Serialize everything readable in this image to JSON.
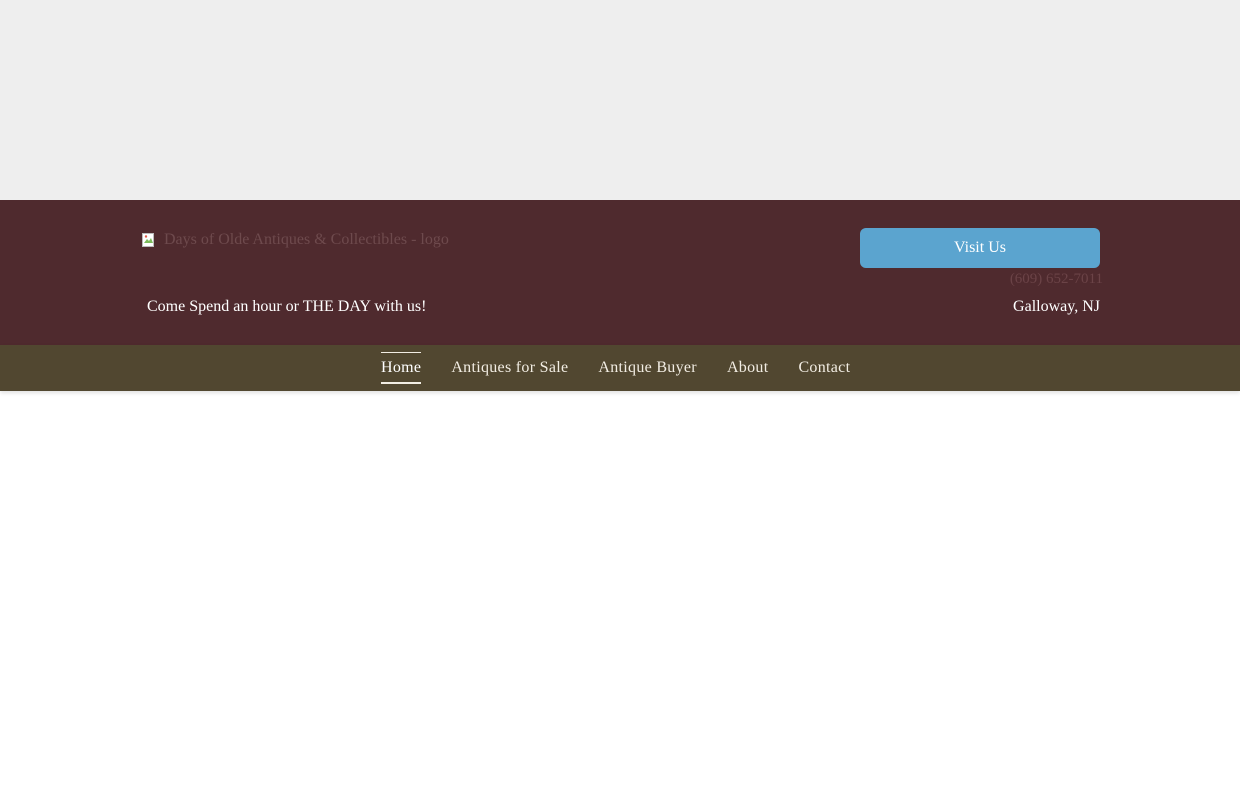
{
  "header": {
    "logo_alt": "Days of Olde Antiques & Collectibles - logo",
    "tagline": "Come Spend an hour or THE DAY with us!",
    "visit_button_label": "Visit Us",
    "phone": "(609) 652-7011",
    "location": "Galloway, NJ"
  },
  "nav": {
    "items": [
      {
        "label": "Home",
        "active": true
      },
      {
        "label": "Antiques for Sale",
        "active": false
      },
      {
        "label": "Antique Buyer",
        "active": false
      },
      {
        "label": "About",
        "active": false
      },
      {
        "label": "Contact",
        "active": false
      }
    ]
  },
  "colors": {
    "banner_bg": "#eeeeee",
    "header_bg": "#4f2a2e",
    "nav_bg": "#514730",
    "button_bg": "#5ba4cf"
  },
  "icons": {
    "logo": "broken-image-icon"
  }
}
